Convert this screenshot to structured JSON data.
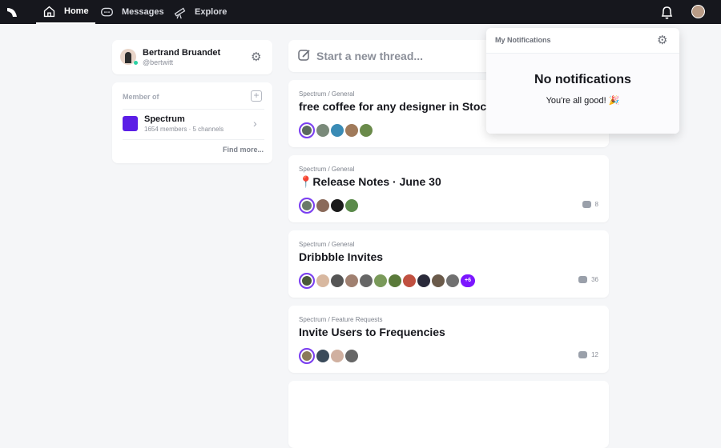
{
  "nav": {
    "items": [
      {
        "label": "Home"
      },
      {
        "label": "Messages"
      },
      {
        "label": "Explore"
      }
    ]
  },
  "profile": {
    "name": "Bertrand Bruandet",
    "handle": "@bertwitt"
  },
  "members": {
    "label": "Member of",
    "community": {
      "name": "Spectrum",
      "meta": "1654 members · 5 channels"
    },
    "find_more": "Find more..."
  },
  "composer": {
    "placeholder": "Start a new thread..."
  },
  "threads": [
    {
      "crumb": "Spectrum / General",
      "title": "free coffee for any designer in Stockholm",
      "faces": [
        "#5b6b5e",
        "#7a8a7a",
        "#3a8bb5",
        "#a07a5a",
        "#6a8a4a"
      ],
      "more": "",
      "count": ""
    },
    {
      "crumb": "Spectrum / General",
      "title": "📍Release Notes · June 30",
      "faces": [
        "#6a7a6a",
        "#8a6a5a",
        "#1a1a1a",
        "#5a8a4a"
      ],
      "more": "",
      "count": "8"
    },
    {
      "crumb": "Spectrum / General",
      "title": "Dribbble Invites",
      "faces": [
        "#4a5a3a",
        "#d8b8a0",
        "#555",
        "#a08070",
        "#666",
        "#7a9a5a",
        "#5a7a3a",
        "#c05040",
        "#2a2a3a",
        "#6a5a4a",
        "#707070"
      ],
      "more": "+6",
      "count": "36"
    },
    {
      "crumb": "Spectrum / Feature Requests",
      "title": "Invite Users to Frequencies",
      "faces": [
        "#8a7a5a",
        "#3a4a5a",
        "#d0b0a0",
        "#666"
      ],
      "more": "",
      "count": "12"
    }
  ],
  "notifications": {
    "title": "My Notifications",
    "empty_title": "No notifications",
    "empty_text": "You're all good! 🎉"
  }
}
